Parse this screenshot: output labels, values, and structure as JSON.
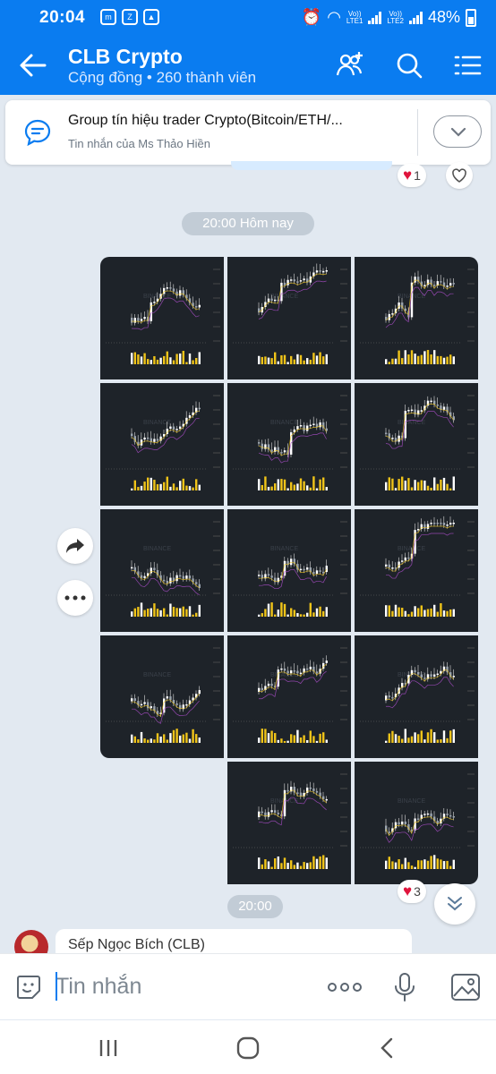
{
  "status_bar": {
    "time": "20:04",
    "network_1": "LTE1",
    "network_2": "LTE2",
    "vo1": "Vo))",
    "vo2": "Vo))",
    "battery": "48%"
  },
  "header": {
    "title": "CLB Crypto",
    "subtitle": "Cộng đồng • 260 thành viên",
    "buttons": [
      "back-icon",
      "add-member-icon",
      "search-icon",
      "menu-list-icon"
    ]
  },
  "pinned_message": {
    "title": "Group tín hiệu trader Crypto(Bitcoin/ETH/...",
    "sender": "Tin nhắn của Ms Thảo Hiền"
  },
  "previous_message": {
    "reaction_count": "1"
  },
  "timestamp_divider": "20:00 Hôm nay",
  "photo_album": {
    "photo_count": 14,
    "watermark": "BINANCE",
    "reaction_count": "3",
    "time": "20:00"
  },
  "next_message": {
    "sender": "Sếp Ngọc Bích (CLB)"
  },
  "input": {
    "placeholder": "Tin nhắn"
  },
  "colors": {
    "header_blue": "#0a7cf0",
    "chat_bg": "#e2e9f1",
    "chart_bg": "#1e2329",
    "candle_up": "#ffffff",
    "volume_yellow": "#f0c419"
  }
}
